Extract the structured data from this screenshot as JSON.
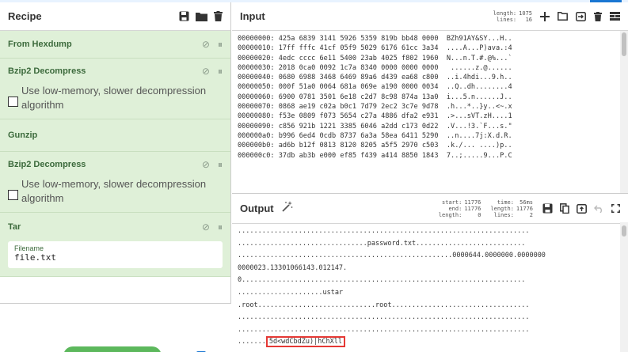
{
  "recipe": {
    "title": "Recipe",
    "operations": [
      {
        "name": "From Hexdump"
      },
      {
        "name": "Bzip2 Decompress",
        "option": "Use low-memory, slower decompression algorithm"
      },
      {
        "name": "Gunzip"
      },
      {
        "name": "Bzip2 Decompress",
        "option": "Use low-memory, slower decompression algorithm"
      },
      {
        "name": "Tar",
        "field_label": "Filename",
        "field_value": "file.txt"
      }
    ]
  },
  "input": {
    "title": "Input",
    "length_label": "length:",
    "length_value": "1075",
    "lines_label": "lines:",
    "lines_value": "16",
    "hexdump": [
      "00000000: 425a 6839 3141 5926 5359 819b bb48 0000  BZh91AY&SY...H..",
      "00000010: 17ff fffc 41cf 05f9 5029 6176 61cc 3a34  ....A...P)ava.:4",
      "00000020: 4edc cccc 6e11 5400 23ab 4025 f802 1960  N...n.T.#.@%...`",
      "00000030: 2018 0ca0 0092 1c7a 8340 0000 0000 0000   ......z.@......",
      "00000040: 0680 6988 3468 6469 89a6 d439 ea68 c800  ..i.4hdi...9.h..",
      "00000050: 000f 51a0 0064 681a 069e a190 0000 0034  ..Q..dh........4",
      "00000060: 6900 0781 3501 6e18 c2d7 8c98 874a 13a0  i...5.n......J..",
      "00000070: 0868 ae19 c02a b0c1 7d79 2ec2 3c7e 9d78  .h...*..}y..<~.x",
      "00000080: f53e 0809 f073 5654 c27a 4886 dfa2 e931  .>...sVT.zH....1",
      "00000090: c856 921b 1221 3385 6046 a2dd c173 0d22  .V...!3.`F...s.\"",
      "000000a0: b996 6ed4 0cdb 8737 6a3a 58ea 6411 5290  ..n....7j:X.d.R.",
      "000000b0: ad6b b12f 0813 8120 8205 a5f5 2970 c503  .k./... ....)p..",
      "000000c0: 37db ab3b e000 ef85 f439 a414 8850 1843  7..;.....9...P.C"
    ]
  },
  "output": {
    "title": "Output",
    "start_label": "start:",
    "start_value": "11776",
    "end_label": "end:",
    "end_value": "11776",
    "olength_label": "length:",
    "olength_value": "0",
    "time_label": "time:",
    "time_value": "56ms",
    "length_label": "length:",
    "length_value": "11776",
    "lines_label": "lines:",
    "lines_value": "2",
    "lines": [
      "........................................................................",
      "................................password.txt...........................",
      ".....................................................0000644.0000000.0000000",
      "0000023.13301066143.012147.",
      "0......................................................................",
      ".....................ustar",
      ".root.............................root..................................",
      "........................................................................",
      "........................................................................"
    ],
    "last_prefix": ".......",
    "highlight": "5d<wdCbdZu)|hChXll"
  },
  "colors": {
    "op_bg": "#dff0d8",
    "highlight_border": "#e53935",
    "bake_green": "#5cb85c",
    "accent_blue": "#1976d2"
  }
}
